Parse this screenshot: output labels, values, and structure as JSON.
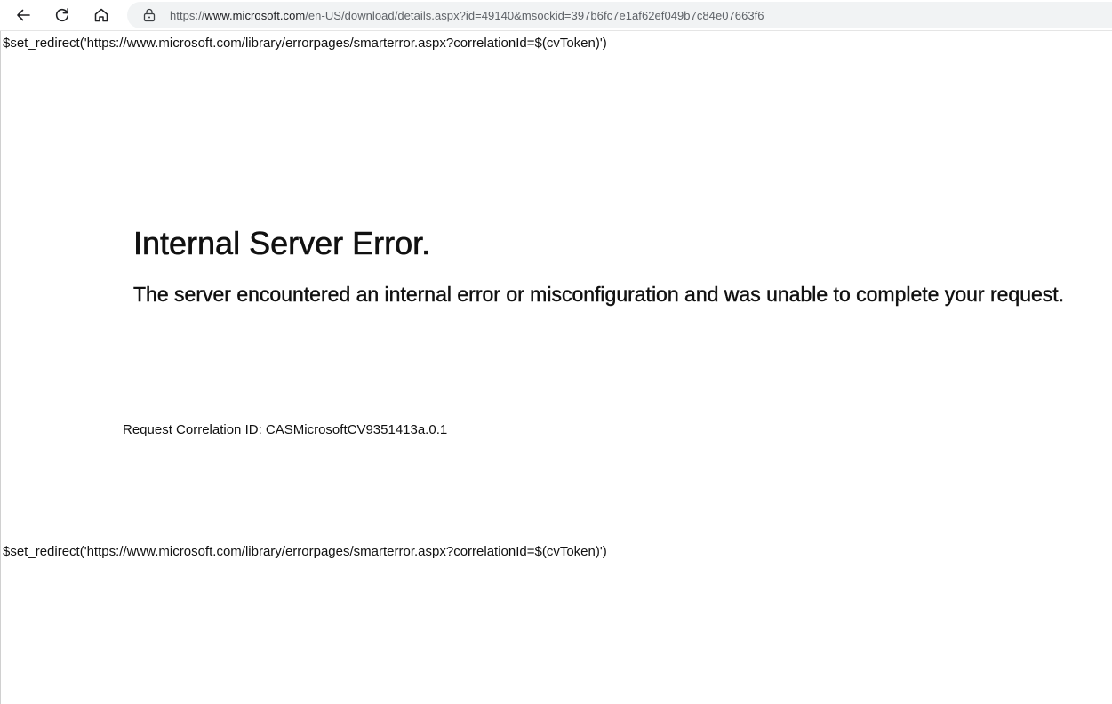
{
  "browser": {
    "back_icon": "arrow-left-icon",
    "reload_icon": "reload-icon",
    "home_icon": "home-icon",
    "lock_icon": "lock-icon",
    "url_prefix": "https://",
    "url_host": "www.microsoft.com",
    "url_path": "/en-US/download/details.aspx?id=49140&msockid=397b6fc7e1af62ef049b7c84e07663f6"
  },
  "page": {
    "redirect_line_top": "$set_redirect('https://www.microsoft.com/library/errorpages/smarterror.aspx?correlationId=$(cvToken)')",
    "title": "Internal Server Error.",
    "message": "The server encountered an internal error or misconfiguration and was unable to complete your request.",
    "correlation_label": "Request Correlation ID:",
    "correlation_id": "CASMicrosoftCV9351413a.0.1",
    "redirect_line_bottom": "$set_redirect('https://www.microsoft.com/library/errorpages/smarterror.aspx?correlationId=$(cvToken)')"
  }
}
